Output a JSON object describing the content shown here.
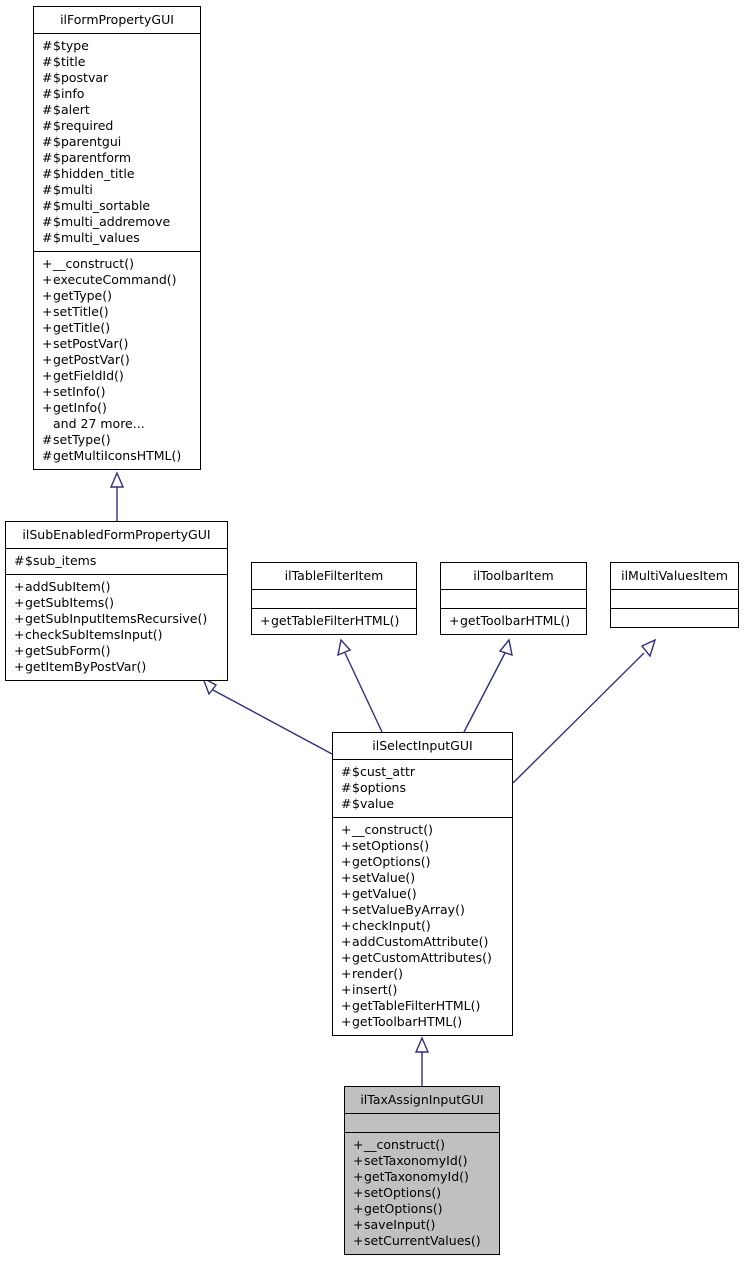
{
  "diagram": {
    "kind": "uml-class-inheritance-diagram",
    "background_color": "#ffffff",
    "edge_color": "#2f2f7f",
    "box_border_color": "#000000",
    "highlight_fill": "#c0c0c0",
    "classes": [
      {
        "id": "ilFormPropertyGUI",
        "name": "ilFormPropertyGUI",
        "highlighted": false,
        "attributes": [
          {
            "visibility": "#",
            "name": "$type"
          },
          {
            "visibility": "#",
            "name": "$title"
          },
          {
            "visibility": "#",
            "name": "$postvar"
          },
          {
            "visibility": "#",
            "name": "$info"
          },
          {
            "visibility": "#",
            "name": "$alert"
          },
          {
            "visibility": "#",
            "name": "$required"
          },
          {
            "visibility": "#",
            "name": "$parentgui"
          },
          {
            "visibility": "#",
            "name": "$parentform"
          },
          {
            "visibility": "#",
            "name": "$hidden_title"
          },
          {
            "visibility": "#",
            "name": "$multi"
          },
          {
            "visibility": "#",
            "name": "$multi_sortable"
          },
          {
            "visibility": "#",
            "name": "$multi_addremove"
          },
          {
            "visibility": "#",
            "name": "$multi_values"
          }
        ],
        "operations": [
          {
            "visibility": "+",
            "name": "__construct()"
          },
          {
            "visibility": "+",
            "name": "executeCommand()"
          },
          {
            "visibility": "+",
            "name": "getType()"
          },
          {
            "visibility": "+",
            "name": "setTitle()"
          },
          {
            "visibility": "+",
            "name": "getTitle()"
          },
          {
            "visibility": "+",
            "name": "setPostVar()"
          },
          {
            "visibility": "+",
            "name": "getPostVar()"
          },
          {
            "visibility": "+",
            "name": "getFieldId()"
          },
          {
            "visibility": "+",
            "name": "setInfo()"
          },
          {
            "visibility": "+",
            "name": "getInfo()"
          },
          {
            "visibility": "",
            "name": "and 27 more..."
          },
          {
            "visibility": "#",
            "name": "setType()"
          },
          {
            "visibility": "#",
            "name": "getMultiIconsHTML()"
          }
        ]
      },
      {
        "id": "ilSubEnabledFormPropertyGUI",
        "name": "ilSubEnabledFormPropertyGUI",
        "highlighted": false,
        "attributes": [
          {
            "visibility": "#",
            "name": "$sub_items"
          }
        ],
        "operations": [
          {
            "visibility": "+",
            "name": "addSubItem()"
          },
          {
            "visibility": "+",
            "name": "getSubItems()"
          },
          {
            "visibility": "+",
            "name": "getSubInputItemsRecursive()"
          },
          {
            "visibility": "+",
            "name": "checkSubItemsInput()"
          },
          {
            "visibility": "+",
            "name": "getSubForm()"
          },
          {
            "visibility": "+",
            "name": "getItemByPostVar()"
          }
        ]
      },
      {
        "id": "ilTableFilterItem",
        "name": "ilTableFilterItem",
        "highlighted": false,
        "attributes": [],
        "operations": [
          {
            "visibility": "+",
            "name": "getTableFilterHTML()"
          }
        ]
      },
      {
        "id": "ilToolbarItem",
        "name": "ilToolbarItem",
        "highlighted": false,
        "attributes": [],
        "operations": [
          {
            "visibility": "+",
            "name": "getToolbarHTML()"
          }
        ]
      },
      {
        "id": "ilMultiValuesItem",
        "name": "ilMultiValuesItem",
        "highlighted": false,
        "attributes": [],
        "operations": []
      },
      {
        "id": "ilSelectInputGUI",
        "name": "ilSelectInputGUI",
        "highlighted": false,
        "attributes": [
          {
            "visibility": "#",
            "name": "$cust_attr"
          },
          {
            "visibility": "#",
            "name": "$options"
          },
          {
            "visibility": "#",
            "name": "$value"
          }
        ],
        "operations": [
          {
            "visibility": "+",
            "name": "__construct()"
          },
          {
            "visibility": "+",
            "name": "setOptions()"
          },
          {
            "visibility": "+",
            "name": "getOptions()"
          },
          {
            "visibility": "+",
            "name": "setValue()"
          },
          {
            "visibility": "+",
            "name": "getValue()"
          },
          {
            "visibility": "+",
            "name": "setValueByArray()"
          },
          {
            "visibility": "+",
            "name": "checkInput()"
          },
          {
            "visibility": "+",
            "name": "addCustomAttribute()"
          },
          {
            "visibility": "+",
            "name": "getCustomAttributes()"
          },
          {
            "visibility": "+",
            "name": "render()"
          },
          {
            "visibility": "+",
            "name": "insert()"
          },
          {
            "visibility": "+",
            "name": "getTableFilterHTML()"
          },
          {
            "visibility": "+",
            "name": "getToolbarHTML()"
          }
        ]
      },
      {
        "id": "ilTaxAssignInputGUI",
        "name": "ilTaxAssignInputGUI",
        "highlighted": true,
        "attributes": [],
        "operations": [
          {
            "visibility": "+",
            "name": "__construct()"
          },
          {
            "visibility": "+",
            "name": "setTaxonomyId()"
          },
          {
            "visibility": "+",
            "name": "getTaxonomyId()"
          },
          {
            "visibility": "+",
            "name": "setOptions()"
          },
          {
            "visibility": "+",
            "name": "getOptions()"
          },
          {
            "visibility": "+",
            "name": "saveInput()"
          },
          {
            "visibility": "+",
            "name": "setCurrentValues()"
          }
        ]
      }
    ],
    "relations": [
      {
        "type": "generalization",
        "from": "ilSubEnabledFormPropertyGUI",
        "to": "ilFormPropertyGUI"
      },
      {
        "type": "generalization",
        "from": "ilSelectInputGUI",
        "to": "ilSubEnabledFormPropertyGUI"
      },
      {
        "type": "realization",
        "from": "ilSelectInputGUI",
        "to": "ilTableFilterItem"
      },
      {
        "type": "realization",
        "from": "ilSelectInputGUI",
        "to": "ilToolbarItem"
      },
      {
        "type": "realization",
        "from": "ilSelectInputGUI",
        "to": "ilMultiValuesItem"
      },
      {
        "type": "generalization",
        "from": "ilTaxAssignInputGUI",
        "to": "ilSelectInputGUI"
      }
    ]
  }
}
